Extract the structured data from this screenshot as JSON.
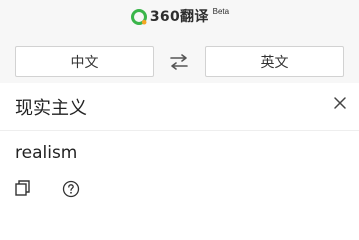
{
  "header": {
    "logo_text": "360翻译",
    "badge": "Beta",
    "logo_icon": "360-logo-icon",
    "logo_colors": [
      "#3ab54a",
      "#f5a623"
    ]
  },
  "language_bar": {
    "source_language": "中文",
    "target_language": "英文",
    "swap_icon": "swap-arrows-icon"
  },
  "input": {
    "text": "现实主义",
    "clear_icon": "close-icon"
  },
  "output": {
    "text": "realism",
    "copy_icon": "copy-icon",
    "help_icon": "help-icon"
  }
}
